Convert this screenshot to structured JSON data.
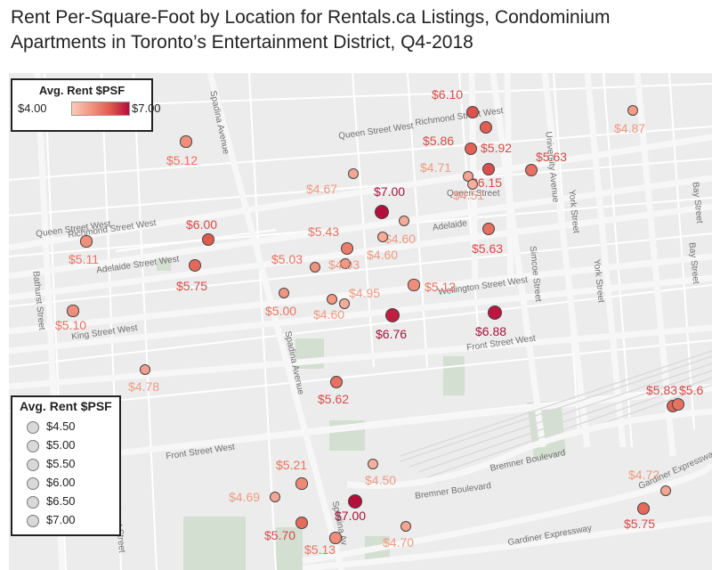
{
  "title": "Rent Per-Square-Foot by Location for Rentals.ca Listings, Condominium Apartments in Toronto’s Entertainment District, Q4-2018",
  "legend_color": {
    "title": "Avg. Rent $PSF",
    "min_label": "$4.00",
    "max_label": "$7.00",
    "colors": [
      "#fbcbb9",
      "#b50d3c"
    ]
  },
  "legend_size": {
    "title": "Avg. Rent $PSF",
    "items": [
      "$4.50",
      "$5.00",
      "$5.50",
      "$6.00",
      "$6.50",
      "$7.00"
    ]
  },
  "streets": [
    "Queen Street West",
    "Queen Street West",
    "Richmond Street West",
    "Richmond Street West",
    "Adelaide Street West",
    "Adelaide",
    "Wellington Street West",
    "King Street West",
    "Front Street West",
    "Front Street West",
    "Bremner Boulevard",
    "Bremner Boulevard",
    "Gardiner Expressway",
    "Gardiner Expressway",
    "Spadina Avenue",
    "Spadina Avenue",
    "Spadina Av",
    "Bathurst Street",
    "Bathurst Street",
    "Simcoe Street",
    "University Avenue",
    "York Street",
    "York Street",
    "Bay Street",
    "Bay Street",
    "Queen Street"
  ],
  "listings": [
    {
      "label": "$6.10",
      "rent": 6.1
    },
    {
      "label": "$5.86",
      "rent": 5.86
    },
    {
      "label": "$5.92",
      "rent": 5.92
    },
    {
      "label": "$4.87",
      "rent": 4.87
    },
    {
      "label": "$5.12",
      "rent": 5.12
    },
    {
      "label": "$4.71",
      "rent": 4.71
    },
    {
      "label": "$6.15",
      "rent": 6.15
    },
    {
      "label": "$5.63",
      "rent": 5.63
    },
    {
      "label": "$4.67",
      "rent": 4.67
    },
    {
      "label": "$4.51",
      "rent": 4.51
    },
    {
      "label": "$7.00",
      "rent": 7.0
    },
    {
      "label": "$6.00",
      "rent": 6.0
    },
    {
      "label": "$5.43",
      "rent": 5.43
    },
    {
      "label": "$4.60",
      "rent": 4.6
    },
    {
      "label": "$5.11",
      "rent": 5.11
    },
    {
      "label": "$4.60",
      "rent": 4.6
    },
    {
      "label": "$5.63",
      "rent": 5.63
    },
    {
      "label": "$5.03",
      "rent": 5.03
    },
    {
      "label": "$4.93",
      "rent": 4.93
    },
    {
      "label": "$5.75",
      "rent": 5.75
    },
    {
      "label": "$4.95",
      "rent": 4.95
    },
    {
      "label": "$5.12",
      "rent": 5.12
    },
    {
      "label": "$5.00",
      "rent": 5.0
    },
    {
      "label": "$4.60",
      "rent": 4.6
    },
    {
      "label": "$5.10",
      "rent": 5.1
    },
    {
      "label": "$6.76",
      "rent": 6.76
    },
    {
      "label": "$6.88",
      "rent": 6.88
    },
    {
      "label": "$4.78",
      "rent": 4.78
    },
    {
      "label": "$5.62",
      "rent": 5.62
    },
    {
      "label": "$5.83",
      "rent": 5.83
    },
    {
      "label": "$5.6",
      "rent": 5.6
    },
    {
      "label": "$5.21",
      "rent": 5.21
    },
    {
      "label": "$4.50",
      "rent": 4.5
    },
    {
      "label": "$4.72",
      "rent": 4.72
    },
    {
      "label": "$4.69",
      "rent": 4.69
    },
    {
      "label": "$7.00",
      "rent": 7.0
    },
    {
      "label": "$5.75",
      "rent": 5.75
    },
    {
      "label": "$5.70",
      "rent": 5.7
    },
    {
      "label": "$4.70",
      "rent": 4.7
    },
    {
      "label": "$5.13",
      "rent": 5.13
    }
  ]
}
